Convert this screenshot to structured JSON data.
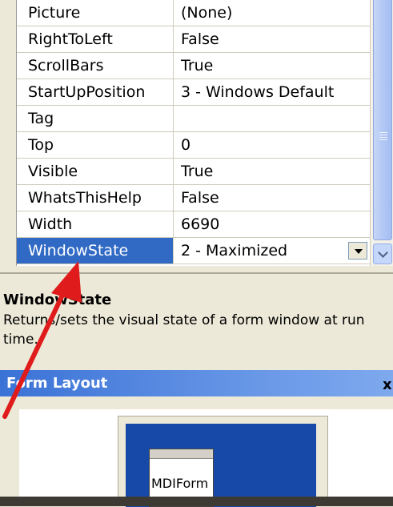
{
  "properties": [
    {
      "name": "Picture",
      "value": "(None)"
    },
    {
      "name": "RightToLeft",
      "value": "False"
    },
    {
      "name": "ScrollBars",
      "value": "True"
    },
    {
      "name": "StartUpPosition",
      "value": "3 - Windows Default"
    },
    {
      "name": "Tag",
      "value": ""
    },
    {
      "name": "Top",
      "value": "0"
    },
    {
      "name": "Visible",
      "value": "True"
    },
    {
      "name": "WhatsThisHelp",
      "value": "False"
    },
    {
      "name": "Width",
      "value": "6690"
    },
    {
      "name": "WindowState",
      "value": "2 - Maximized",
      "selected": true
    }
  ],
  "description": {
    "title": "WindowState",
    "text": "Returns/sets the visual state of a form window at run time."
  },
  "form_layout": {
    "title": "Form Layout",
    "close_label": "x",
    "form_label": "MDIForm"
  },
  "colors": {
    "selection": "#316ac5",
    "annotation_arrow": "#e01b1b",
    "screen": "#174aa8"
  }
}
